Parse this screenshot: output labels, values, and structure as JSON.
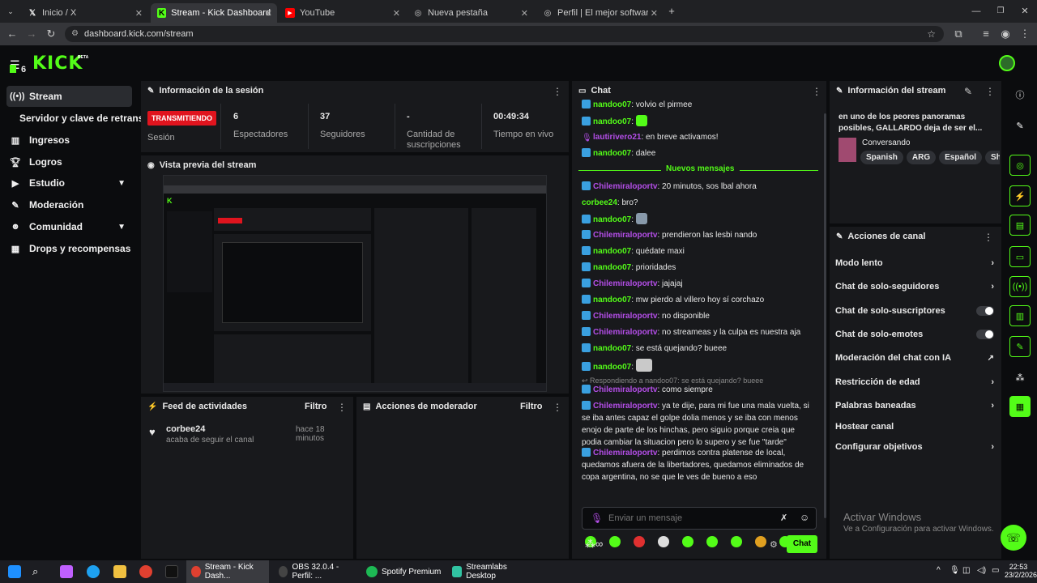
{
  "browser": {
    "tabs": [
      {
        "title": "Inicio / X",
        "favicon": "x-icon"
      },
      {
        "title": "Stream - Kick Dashboard",
        "favicon": "kick-icon"
      },
      {
        "title": "YouTube",
        "favicon": "youtube-icon"
      },
      {
        "title": "Nueva pestaña",
        "favicon": "globe-icon"
      },
      {
        "title": "Perfil | El mejor software para p",
        "favicon": "streamlabs-icon"
      }
    ],
    "url": "dashboard.kick.com/stream"
  },
  "brand": {
    "logo_text": "KICK",
    "beta": "BETA",
    "notif_count": "6"
  },
  "sidebar": {
    "items": [
      {
        "label": "Stream",
        "icon": "broadcast-icon"
      },
      {
        "label": "Servidor y clave de retransm",
        "icon": ""
      },
      {
        "label": "Ingresos",
        "icon": "chart-icon"
      },
      {
        "label": "Logros",
        "icon": "trophy-icon"
      },
      {
        "label": "Estudio",
        "icon": "video-icon"
      },
      {
        "label": "Moderación",
        "icon": "wrench-icon"
      },
      {
        "label": "Comunidad",
        "icon": "users-icon"
      },
      {
        "label": "Drops y recompensas",
        "icon": "gift-icon"
      }
    ]
  },
  "session": {
    "title": "Información de la sesión",
    "live_badge": "TRANSMITIENDO",
    "session_label": "Sesión",
    "stats": [
      {
        "value": "6",
        "label": "Espectadores"
      },
      {
        "value": "37",
        "label": "Seguidores"
      },
      {
        "value": "-",
        "label": "Cantidad de suscripciones"
      },
      {
        "value": "00:49:34",
        "label": "Tiempo en vivo"
      }
    ]
  },
  "preview": {
    "title": "Vista previa del stream"
  },
  "activity": {
    "title": "Feed de actividades",
    "filter": "Filtro",
    "items": [
      {
        "user": "corbee24",
        "text": "acaba de seguir el canal",
        "time": "hace 18 minutos"
      }
    ]
  },
  "mod_actions": {
    "title": "Acciones de moderador",
    "filter": "Filtro"
  },
  "chat": {
    "title": "Chat",
    "new_messages": "Nuevos mensajes",
    "messages": [
      {
        "user": "nandoo07",
        "text": ": volvio el pirmee",
        "color": "#53fc18"
      },
      {
        "user": "nandoo07",
        "text": ":",
        "color": "#53fc18"
      },
      {
        "user": "lautirivero21",
        "text": ": en breve activamos!",
        "color": "#b44ee8"
      },
      {
        "user": "nandoo07",
        "text": ": dalee",
        "color": "#53fc18"
      },
      {
        "user": "Chilemiraloportv",
        "text": ": 20 minutos, sos lbal ahora",
        "color": "#b44ee8"
      },
      {
        "user": "corbee24",
        "text": ": bro?",
        "color": "#53fc18"
      },
      {
        "user": "nandoo07",
        "text": ":",
        "color": "#53fc18"
      },
      {
        "user": "Chilemiraloportv",
        "text": ": prendieron las lesbi nando",
        "color": "#b44ee8"
      },
      {
        "user": "nandoo07",
        "text": ": quédate maxi",
        "color": "#53fc18"
      },
      {
        "user": "nandoo07",
        "text": ": prioridades",
        "color": "#53fc18"
      },
      {
        "user": "Chilemiraloportv",
        "text": ": jajajaj",
        "color": "#b44ee8"
      },
      {
        "user": "nandoo07",
        "text": ": mw pierdo al villero hoy sí corchazo",
        "color": "#53fc18"
      },
      {
        "user": "Chilemiraloportv",
        "text": ": no disponible",
        "color": "#b44ee8"
      },
      {
        "user": "Chilemiraloportv",
        "text": ": no streameas y la culpa es nuestra aja",
        "color": "#b44ee8"
      },
      {
        "user": "nandoo07",
        "text": ": se está quejando? bueee",
        "color": "#53fc18"
      },
      {
        "user": "nandoo07",
        "text": ":",
        "color": "#53fc18"
      },
      {
        "user": "Chilemiraloportv",
        "text": ": como siempre",
        "color": "#b44ee8"
      },
      {
        "user": "Chilemiraloportv",
        "text": ": ya te dije, para mi fue una mala vuelta, si se iba antes capaz el golpe dolia menos y se iba con menos enojo de parte de los hinchas, pero siguio porque creia que podia cambiar la situacion pero lo supero y se fue \"tarde\"",
        "color": "#b44ee8"
      },
      {
        "user": "Chilemiraloportv",
        "text": ": perdimos contra platense de local, quedamos afuera de la libertadores, quedamos eliminados de copa argentina, no se que le ves de bueno a eso",
        "color": "#b44ee8"
      }
    ],
    "reply_to": "Respondiendo a nandoo07: se está quejando? bueee",
    "input_placeholder": "Enviar un mensaje",
    "send_label": "Chat"
  },
  "stream_info": {
    "title": "Información del stream",
    "stream_title": "en uno de los peores panoramas posibles, GALLARDO deja de ser el...",
    "category": "Conversando",
    "tags": [
      "Spanish",
      "ARG",
      "Español",
      "Sho"
    ]
  },
  "channel_actions": {
    "title": "Acciones de canal",
    "items": [
      {
        "label": "Modo lento",
        "control": "chevron"
      },
      {
        "label": "Chat de solo-seguidores",
        "control": "chevron"
      },
      {
        "label": "Chat de solo-suscriptores",
        "control": "toggle"
      },
      {
        "label": "Chat de solo-emotes",
        "control": "toggle"
      },
      {
        "label": "Moderación del chat con IA",
        "control": "external"
      },
      {
        "label": "Restricción de edad",
        "control": "chevron"
      },
      {
        "label": "Palabras baneadas",
        "control": "chevron"
      },
      {
        "label": "Hostear canal",
        "control": "none"
      },
      {
        "label": "Configurar objetivos",
        "control": "chevron"
      }
    ]
  },
  "watermark": {
    "title": "Activar Windows",
    "subtitle": "Ve a Configuración para activar Windows."
  },
  "taskbar": {
    "apps": [
      {
        "label": "Stream - Kick Dash..."
      },
      {
        "label": "OBS 32.0.4 - Perfil: ..."
      },
      {
        "label": "Spotify Premium"
      },
      {
        "label": "Streamlabs Desktop"
      }
    ],
    "time": "22:53",
    "date": "23/2/2026"
  },
  "colors": {
    "accent": "#53fc18",
    "live": "#e0141e",
    "panel": "#18191c",
    "bg": "#0b0c0e"
  }
}
